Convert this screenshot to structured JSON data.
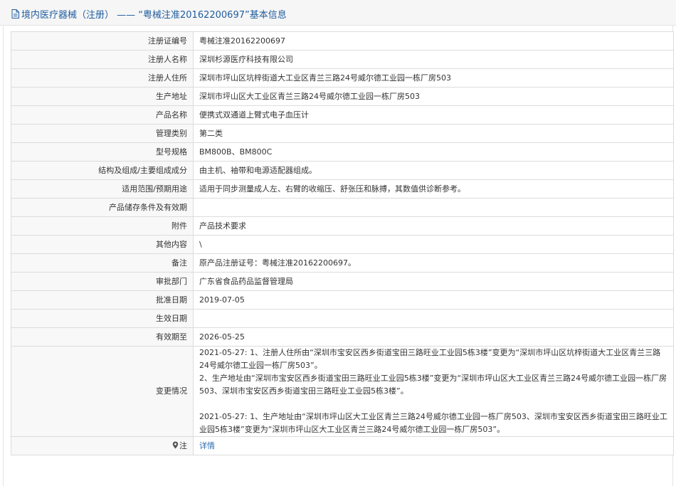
{
  "header": {
    "title": "境内医疗器械（注册） —— “粤械注准20162200697”基本信息"
  },
  "rows": [
    {
      "label": "注册证编号",
      "value": "粤械注准20162200697"
    },
    {
      "label": "注册人名称",
      "value": "深圳杉源医疗科技有限公司"
    },
    {
      "label": "注册人住所",
      "value": "深圳市坪山区坑梓街道大工业区青兰三路24号威尔德工业园一栋厂房503"
    },
    {
      "label": "生产地址",
      "value": "深圳市坪山区大工业区青兰三路24号威尔德工业园一栋厂房503"
    },
    {
      "label": "产品名称",
      "value": "便携式双通道上臂式电子血压计"
    },
    {
      "label": "管理类别",
      "value": "第二类"
    },
    {
      "label": "型号规格",
      "value": "BM800B、BM800C"
    },
    {
      "label": "结构及组成/主要组成成分",
      "value": "由主机、袖带和电源适配器组成。"
    },
    {
      "label": "适用范围/预期用途",
      "value": "适用于同步测量成人左、右臂的收缩压、舒张压和脉搏，其数值供诊断参考。"
    },
    {
      "label": "产品储存条件及有效期",
      "value": ""
    },
    {
      "label": "附件",
      "value": "产品技术要求"
    },
    {
      "label": "其他内容",
      "value": "\\"
    },
    {
      "label": "备注",
      "value": "原产品注册证号：粤械注准20162200697。"
    },
    {
      "label": "审批部门",
      "value": "广东省食品药品监督管理局"
    },
    {
      "label": "批准日期",
      "value": "2019-07-05"
    },
    {
      "label": "生效日期",
      "value": ""
    },
    {
      "label": "有效期至",
      "value": "2026-05-25"
    }
  ],
  "changes": {
    "label": "变更情况",
    "entries": [
      "2021-05-27: 1、注册人住所由“深圳市宝安区西乡街道宝田三路旺业工业园5栋3楼”变更为“深圳市坪山区坑梓街道大工业区青兰三路24号威尔德工业园一栋厂房503”。",
      "2、生产地址由“深圳市宝安区西乡街道宝田三路旺业工业园5栋3楼”变更为“深圳市坪山区大工业区青兰三路24号威尔德工业园一栋厂房503、深圳市宝安区西乡街道宝田三路旺业工业园5栋3楼”。",
      "2021-05-27: 1、生产地址由“深圳市坪山区大工业区青兰三路24号威尔德工业园一栋厂房503、深圳市宝安区西乡街道宝田三路旺业工业园5栋3楼”变更为“深圳市坪山区大工业区青兰三路24号威尔德工业园一栋厂房503”。"
    ]
  },
  "note": {
    "label": "注",
    "link": "详情",
    "icon": "location-pin-icon"
  },
  "colors": {
    "title": "#1f5d9e",
    "link": "#2b6cb0",
    "label_bg": "#f8f8f8",
    "border": "#dcdcdc"
  }
}
